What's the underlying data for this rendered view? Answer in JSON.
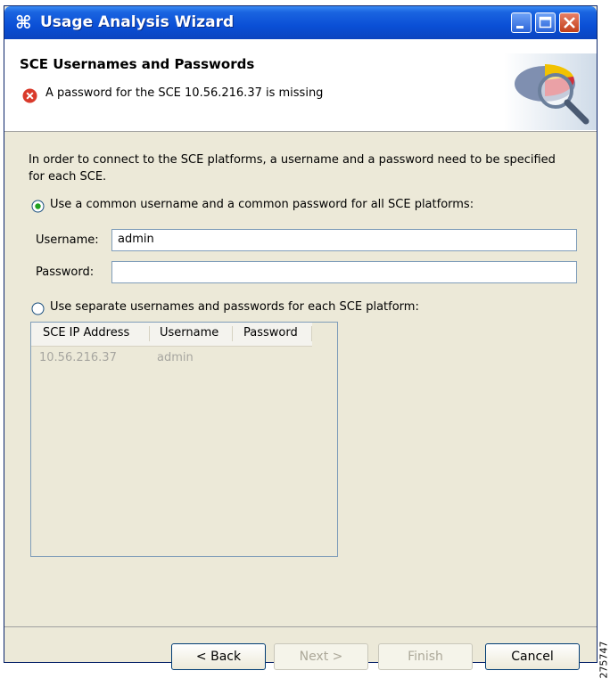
{
  "window": {
    "title": "Usage Analysis Wizard",
    "app_icon": "⌘"
  },
  "header": {
    "title": "SCE Usernames and Passwords",
    "message": "A password for the SCE 10.56.216.37 is missing"
  },
  "content": {
    "intro": "In order to connect to the SCE platforms, a username and a password need to be specified for each SCE.",
    "radio_common": {
      "label": "Use a common username and a common password for all SCE platforms:",
      "selected": true
    },
    "username_label": "Username:",
    "username_value": "admin",
    "password_label": "Password:",
    "password_value": "",
    "radio_separate": {
      "label": "Use separate usernames and passwords for each SCE platform:",
      "selected": false
    },
    "table": {
      "columns": [
        "SCE IP Address",
        "Username",
        "Password"
      ],
      "rows": [
        {
          "ip": "10.56.216.37",
          "username": "admin",
          "password": ""
        }
      ]
    }
  },
  "buttons": {
    "back": "< Back",
    "next": "Next >",
    "finish": "Finish",
    "cancel": "Cancel"
  },
  "figure_id": "275747",
  "colors": {
    "titlebar": "#0a4fd6",
    "window_bg": "#ece9d8",
    "error_red": "#d93a2b",
    "disabled_text": "#aca899"
  }
}
